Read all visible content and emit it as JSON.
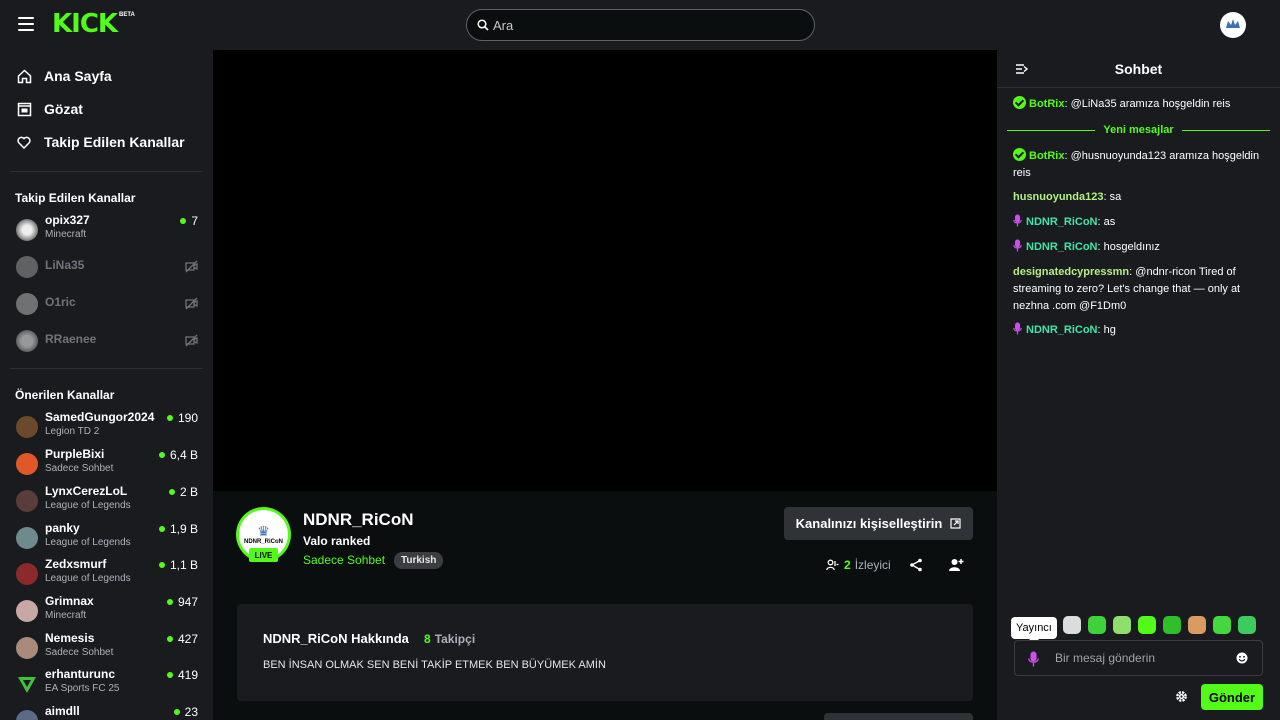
{
  "brand": {
    "logo": "KICK",
    "beta": "BETA",
    "accent": "#53fc18"
  },
  "search": {
    "placeholder": "Ara"
  },
  "nav": [
    {
      "label": "Ana Sayfa",
      "icon": "home-icon"
    },
    {
      "label": "Gözat",
      "icon": "browse-icon"
    },
    {
      "label": "Takip Edilen Kanallar",
      "icon": "heart-icon"
    }
  ],
  "followed": {
    "title": "Takip Edilen Kanallar",
    "channels": [
      {
        "name": "opix327",
        "category": "Minecraft",
        "viewers": "7",
        "live": true
      },
      {
        "name": "LiNa35",
        "live": false
      },
      {
        "name": "O1ric",
        "live": false
      },
      {
        "name": "RRaenee",
        "live": false
      }
    ]
  },
  "recommended": {
    "title": "Önerilen Kanallar",
    "channels": [
      {
        "name": "SamedGungor2024",
        "category": "Legion TD 2",
        "viewers": "190"
      },
      {
        "name": "PurpleBixi",
        "category": "Sadece Sohbet",
        "viewers": "6,4 B"
      },
      {
        "name": "LynxCerezLoL",
        "category": "League of Legends",
        "viewers": "2 B"
      },
      {
        "name": "panky",
        "category": "League of Legends",
        "viewers": "1,9 B"
      },
      {
        "name": "Zedxsmurf",
        "category": "League of Legends",
        "viewers": "1,1 B"
      },
      {
        "name": "Grimnax",
        "category": "Minecraft",
        "viewers": "947"
      },
      {
        "name": "Nemesis",
        "category": "Sadece Sohbet",
        "viewers": "427"
      },
      {
        "name": "erhanturunc",
        "category": "EA Sports FC 25",
        "viewers": "419"
      },
      {
        "name": "aimdll",
        "category": "",
        "viewers": "23"
      }
    ]
  },
  "channel": {
    "name": "NDNR_RiCoN",
    "avatar_text": "NDNR_RiCoN",
    "live": "LIVE",
    "stream_title": "Valo ranked",
    "category": "Sadece Sohbet",
    "language": "Turkish",
    "customize": "Kanalınızı kişiselleştirin",
    "viewer_count": "2",
    "viewer_label": "İzleyici"
  },
  "about": {
    "title": "NDNR_RiCoN Hakkında",
    "followers": "8",
    "followers_label": "Takipçi",
    "description": "BEN İNSAN OLMAK SEN BENİ TAKİP ETMEK BEN BÜYÜMEK AMİN"
  },
  "chat": {
    "title": "Sohbet",
    "new_messages": "Yeni mesajlar",
    "messages": [
      {
        "user": "BotRix",
        "text": "@LiNa35 aramıza hoşgeldin reis",
        "color": "#53fc18"
      },
      {
        "user": "BotRix",
        "text": "@husnuoyunda123 aramıza hoşgeldin reis",
        "color": "#53fc18"
      },
      {
        "user": "husnuoyunda123",
        "text": "sa",
        "color": "#b4f080"
      },
      {
        "user": "NDNR_RiCoN",
        "text": "as",
        "color": "#3ee6a8"
      },
      {
        "user": "NDNR_RiCoN",
        "text": "hosgeldınız",
        "color": "#3ee6a8"
      },
      {
        "user": "designatedcypressmn",
        "text": "@ndnr-ricon Tired of streaming to zero? Let's change that — only at nezhna .com @F1Dm0",
        "color": "#b4f080"
      },
      {
        "user": "NDNR_RiCoN",
        "text": "hg",
        "color": "#3ee6a8"
      }
    ],
    "tooltip": "Yayıncı",
    "placeholder": "Bir mesaj gönderin",
    "send": "Gönder"
  }
}
